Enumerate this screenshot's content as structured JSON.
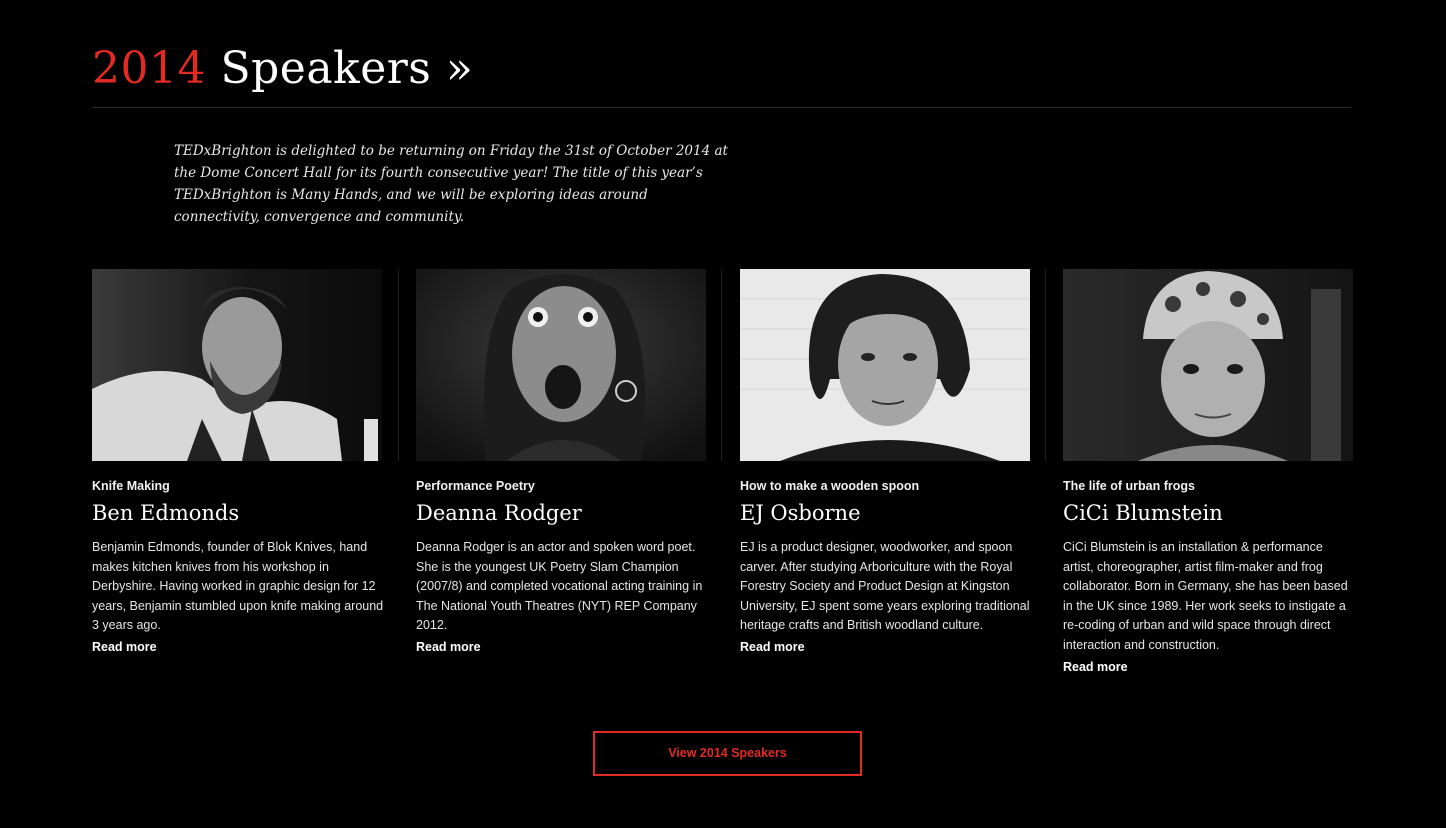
{
  "section": {
    "year": "2014",
    "title": " Speakers »",
    "intro": "TEDxBrighton is delighted to be returning on Friday the 31st of October 2014 at the Dome Concert Hall for its fourth consecutive year! The title of this year’s TEDxBrighton is Many Hands, and we will be exploring ideas around connectivity, convergence and community."
  },
  "speakers": [
    {
      "topic": "Knife Making",
      "name": "Ben Edmonds",
      "bio": "Benjamin Edmonds, founder of Blok Knives, hand makes kitchen knives from his workshop in Derbyshire. Having worked in graphic design for 12 years, Benjamin stumbled upon knife making around 3 years ago.",
      "read_more": "Read more"
    },
    {
      "topic": "Performance Poetry",
      "name": "Deanna Rodger",
      "bio": "Deanna Rodger is an actor and spoken word poet. She is the youngest UK Poetry Slam Champion (2007/8) and completed vocational acting training in The National Youth Theatres (NYT) REP Company 2012.",
      "read_more": "Read more"
    },
    {
      "topic": "How to make a wooden spoon",
      "name": "EJ Osborne",
      "bio": "EJ is a product designer, woodworker, and spoon carver. After studying Arboriculture with the Royal Forestry Society and Product Design at Kingston University, EJ spent some years exploring traditional heritage crafts and British woodland culture.",
      "read_more": "Read more"
    },
    {
      "topic": "The life of urban frogs",
      "name": "CiCi Blumstein",
      "bio": "CiCi Blumstein is an installation & performance artist, choreographer, artist film-maker and frog collaborator. Born in Germany, she has been based in the UK since 1989. Her work seeks to instigate a re-coding of urban and wild space through direct interaction and construction.",
      "read_more": "Read more"
    }
  ],
  "cta": {
    "label": "View 2014 Speakers"
  },
  "colors": {
    "accent": "#e02a23",
    "background": "#000000",
    "text": "#ffffff"
  }
}
